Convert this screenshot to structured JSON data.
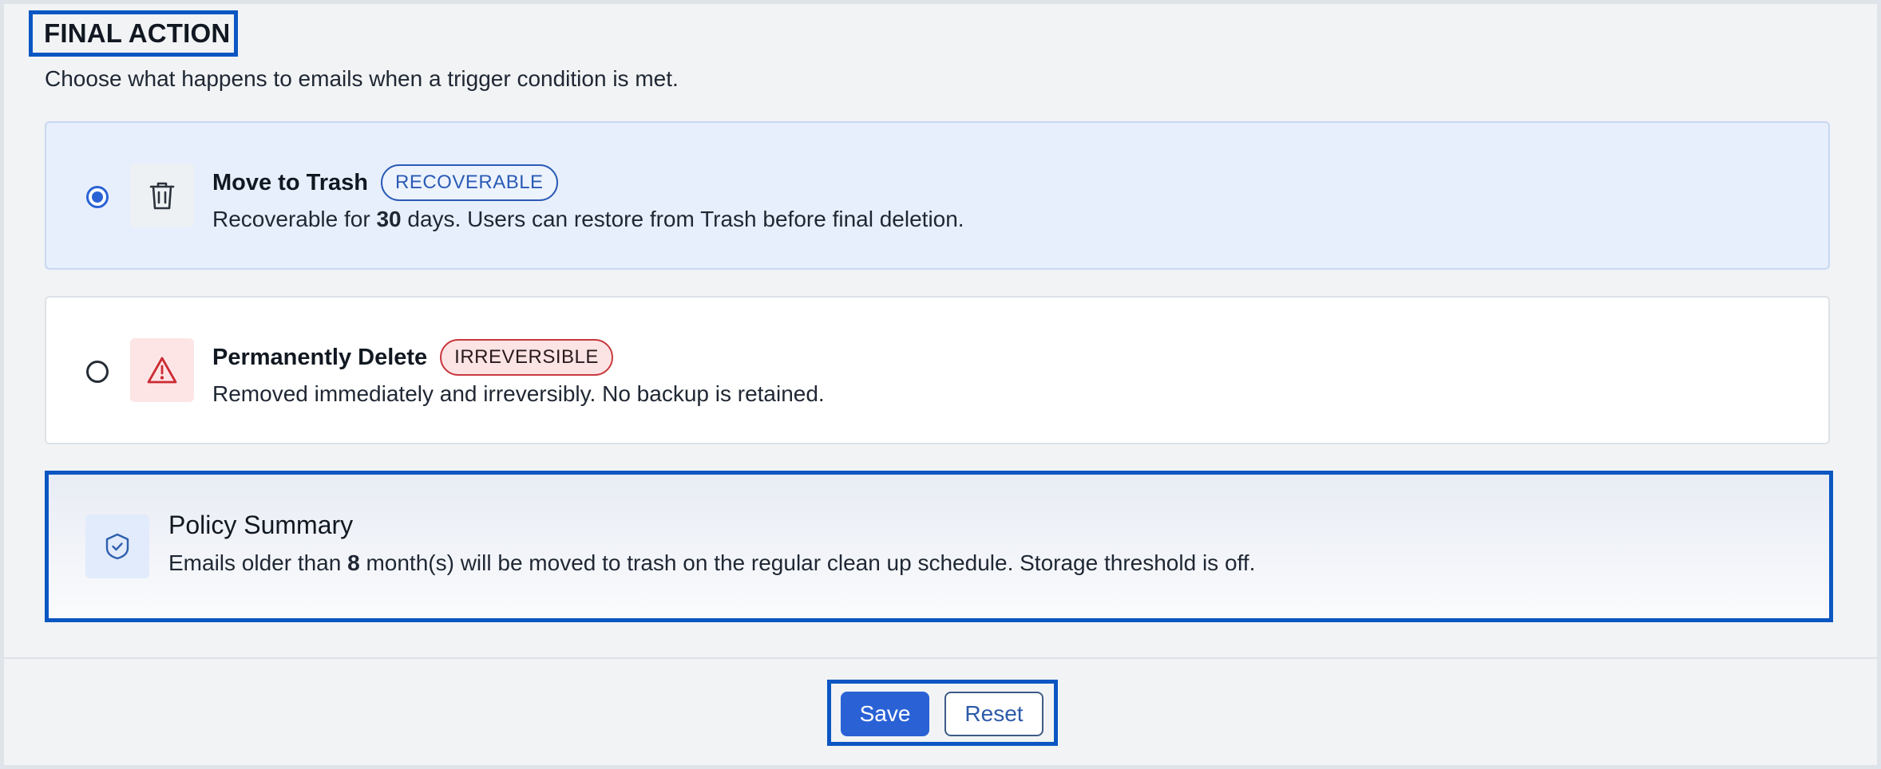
{
  "section": {
    "title": "FINAL ACTION",
    "description": "Choose what happens to emails when a trigger condition is met."
  },
  "options": [
    {
      "title": "Move to Trash",
      "badge": "RECOVERABLE",
      "selected": true,
      "icon": "trash-icon",
      "desc_prefix": "Recoverable for ",
      "desc_value": "30",
      "desc_suffix": " days. Users can restore from Trash before final deletion."
    },
    {
      "title": "Permanently Delete",
      "badge": "IRREVERSIBLE",
      "selected": false,
      "icon": "warning-icon",
      "desc": "Removed immediately and irreversibly. No backup is retained."
    }
  ],
  "summary": {
    "icon": "shield-check-icon",
    "title": "Policy Summary",
    "text_prefix": "Emails older than ",
    "text_value": "8",
    "text_suffix": " month(s) will be moved to trash on the regular clean up schedule. Storage threshold is off."
  },
  "actions": {
    "save_label": "Save",
    "reset_label": "Reset"
  },
  "colors": {
    "accent": "#2a62d6",
    "highlight_border": "#0b56c2",
    "danger": "#c9393f",
    "selected_bg": "#e7effc"
  }
}
